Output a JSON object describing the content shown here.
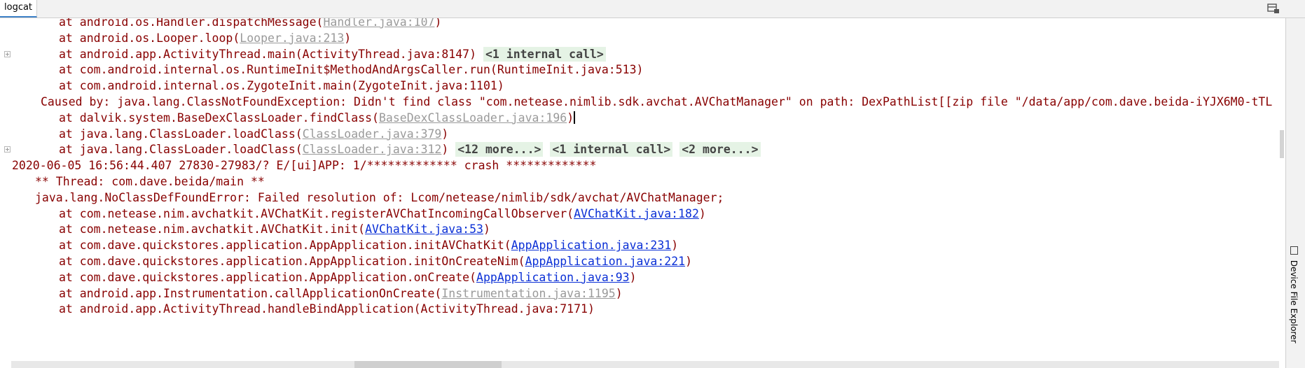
{
  "window": {
    "tab_label": "logcat"
  },
  "side_panel": {
    "label": "Device File Explorer"
  },
  "colors": {
    "error_text": "#880000",
    "link_blue": "#0a2fd6",
    "link_gray": "#9a9a9a",
    "badge_bg": "#e5f3e5"
  },
  "icons": {
    "layout": "layout-icon",
    "fold": "fold-plus-icon",
    "device": "device-icon"
  },
  "lines": [
    {
      "indent": 3,
      "text": "at android.os.Handler.dispatchMessage(",
      "link": "Handler.java:107",
      "link_style": "gray",
      "tail": ")"
    },
    {
      "indent": 3,
      "text": "at android.os.Looper.loop(",
      "link": "Looper.java:213",
      "link_style": "gray",
      "tail": ")"
    },
    {
      "indent": 3,
      "fold": true,
      "text": "at android.app.ActivityThread.main(ActivityThread.java:8147) ",
      "badges": [
        "<1 internal call>"
      ]
    },
    {
      "indent": 3,
      "text": "at com.android.internal.os.RuntimeInit$MethodAndArgsCaller.run(RuntimeInit.java:513)"
    },
    {
      "indent": 3,
      "text": "at com.android.internal.os.ZygoteInit.main(ZygoteInit.java:1101)"
    },
    {
      "indent": 2,
      "text": "Caused by: java.lang.ClassNotFoundException: Didn't find class \"com.netease.nimlib.sdk.avchat.AVChatManager\" on path: DexPathList[[zip file \"/data/app/com.dave.beida-iYJX6M0-tTL"
    },
    {
      "indent": 3,
      "text": "at dalvik.system.BaseDexClassLoader.findClass(",
      "link": "BaseDexClassLoader.java:196",
      "link_style": "gray",
      "tail": ")",
      "caret": true
    },
    {
      "indent": 3,
      "text": "at java.lang.ClassLoader.loadClass(",
      "link": "ClassLoader.java:379",
      "link_style": "gray",
      "tail": ")"
    },
    {
      "indent": 3,
      "fold": true,
      "text": "at java.lang.ClassLoader.loadClass(",
      "link": "ClassLoader.java:312",
      "link_style": "gray",
      "tail": ") ",
      "badges": [
        "<12 more...>",
        "<1 internal call>",
        "<2 more...>"
      ]
    },
    {
      "indent": 0,
      "text": "2020-06-05 16:56:44.407 27830-27983/? E/[ui]APP: 1/************* crash *************"
    },
    {
      "indent": 1,
      "text": "** Thread: com.dave.beida/main **"
    },
    {
      "indent": 1,
      "text": "java.lang.NoClassDefFoundError: Failed resolution of: Lcom/netease/nimlib/sdk/avchat/AVChatManager;"
    },
    {
      "indent": 3,
      "text": "at com.netease.nim.avchatkit.AVChatKit.registerAVChatIncomingCallObserver(",
      "link": "AVChatKit.java:182",
      "link_style": "blue",
      "tail": ")"
    },
    {
      "indent": 3,
      "text": "at com.netease.nim.avchatkit.AVChatKit.init(",
      "link": "AVChatKit.java:53",
      "link_style": "blue",
      "tail": ")"
    },
    {
      "indent": 3,
      "text": "at com.dave.quickstores.application.AppApplication.initAVChatKit(",
      "link": "AppApplication.java:231",
      "link_style": "blue",
      "tail": ")"
    },
    {
      "indent": 3,
      "text": "at com.dave.quickstores.application.AppApplication.initOnCreateNim(",
      "link": "AppApplication.java:221",
      "link_style": "blue",
      "tail": ")"
    },
    {
      "indent": 3,
      "text": "at com.dave.quickstores.application.AppApplication.onCreate(",
      "link": "AppApplication.java:93",
      "link_style": "blue",
      "tail": ")"
    },
    {
      "indent": 3,
      "text": "at android.app.Instrumentation.callApplicationOnCreate(",
      "link": "Instrumentation.java:1195",
      "link_style": "gray",
      "tail": ")"
    },
    {
      "indent": 3,
      "text": "at android.app.ActivityThread.handleBindApplication(ActivityThread.java:7171)"
    }
  ]
}
